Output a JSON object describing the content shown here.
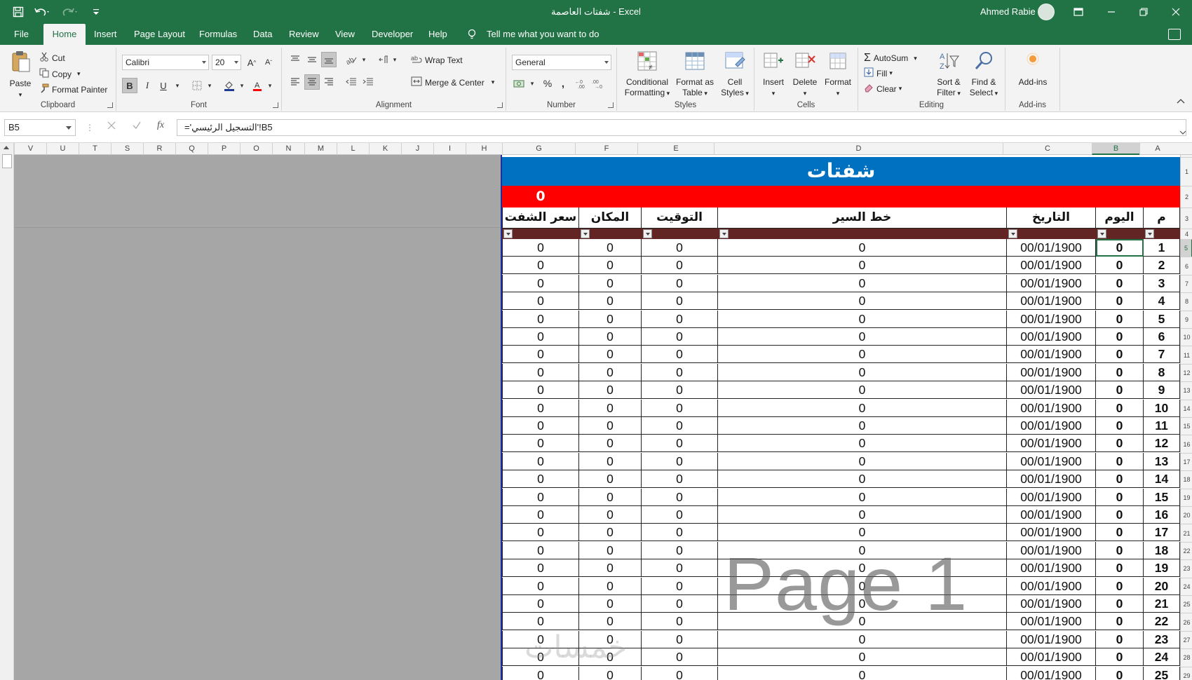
{
  "window": {
    "title": "شفتات العاصمة  -  Excel",
    "user": "Ahmed Rabie"
  },
  "menu": {
    "tabs": [
      "File",
      "Home",
      "Insert",
      "Page Layout",
      "Formulas",
      "Data",
      "Review",
      "View",
      "Developer",
      "Help"
    ],
    "active": "Home",
    "tellme": "Tell me what you want to do"
  },
  "ribbon": {
    "clipboard": {
      "label": "Clipboard",
      "paste": "Paste",
      "cut": "Cut",
      "copy": "Copy",
      "format_painter": "Format Painter"
    },
    "font": {
      "label": "Font",
      "name": "Calibri",
      "size": "20",
      "bold": "B",
      "italic": "I",
      "underline": "U"
    },
    "alignment": {
      "label": "Alignment",
      "wrap": "Wrap Text",
      "merge": "Merge & Center"
    },
    "number": {
      "label": "Number",
      "format": "General",
      "percent": "%",
      "comma": ","
    },
    "styles": {
      "label": "Styles",
      "conditional_1": "Conditional",
      "conditional_2": "Formatting",
      "format_table_1": "Format as",
      "format_table_2": "Table",
      "cell_styles_1": "Cell",
      "cell_styles_2": "Styles"
    },
    "cells": {
      "label": "Cells",
      "insert": "Insert",
      "delete": "Delete",
      "format": "Format"
    },
    "editing": {
      "label": "Editing",
      "autosum": "AutoSum",
      "fill": "Fill",
      "clear": "Clear",
      "sort_1": "Sort &",
      "sort_2": "Filter",
      "find_1": "Find &",
      "find_2": "Select"
    },
    "addins": {
      "label": "Add-ins",
      "button": "Add-ins"
    }
  },
  "formula_bar": {
    "name_box": "B5",
    "formula": "='التسجيل الرئيسي'!B5",
    "fx": "fx"
  },
  "columns": [
    "V",
    "U",
    "T",
    "S",
    "R",
    "Q",
    "P",
    "O",
    "N",
    "M",
    "L",
    "K",
    "J",
    "I",
    "H",
    "G",
    "F",
    "E",
    "D",
    "C",
    "B",
    "A"
  ],
  "sheet": {
    "title": "شفتات",
    "red_value": "0",
    "headers": [
      "سعر الشفت",
      "المكان",
      "التوقيت",
      "خط السير",
      "التاريخ",
      "اليوم",
      "م"
    ],
    "rows": [
      {
        "price": "0",
        "place": "0",
        "time": "0",
        "route": "0",
        "date": "00/01/1900",
        "day": "0",
        "n": "1"
      },
      {
        "price": "0",
        "place": "0",
        "time": "0",
        "route": "0",
        "date": "00/01/1900",
        "day": "0",
        "n": "2"
      },
      {
        "price": "0",
        "place": "0",
        "time": "0",
        "route": "0",
        "date": "00/01/1900",
        "day": "0",
        "n": "3"
      },
      {
        "price": "0",
        "place": "0",
        "time": "0",
        "route": "0",
        "date": "00/01/1900",
        "day": "0",
        "n": "4"
      },
      {
        "price": "0",
        "place": "0",
        "time": "0",
        "route": "0",
        "date": "00/01/1900",
        "day": "0",
        "n": "5"
      },
      {
        "price": "0",
        "place": "0",
        "time": "0",
        "route": "0",
        "date": "00/01/1900",
        "day": "0",
        "n": "6"
      },
      {
        "price": "0",
        "place": "0",
        "time": "0",
        "route": "0",
        "date": "00/01/1900",
        "day": "0",
        "n": "7"
      },
      {
        "price": "0",
        "place": "0",
        "time": "0",
        "route": "0",
        "date": "00/01/1900",
        "day": "0",
        "n": "8"
      },
      {
        "price": "0",
        "place": "0",
        "time": "0",
        "route": "0",
        "date": "00/01/1900",
        "day": "0",
        "n": "9"
      },
      {
        "price": "0",
        "place": "0",
        "time": "0",
        "route": "0",
        "date": "00/01/1900",
        "day": "0",
        "n": "10"
      },
      {
        "price": "0",
        "place": "0",
        "time": "0",
        "route": "0",
        "date": "00/01/1900",
        "day": "0",
        "n": "11"
      },
      {
        "price": "0",
        "place": "0",
        "time": "0",
        "route": "0",
        "date": "00/01/1900",
        "day": "0",
        "n": "12"
      },
      {
        "price": "0",
        "place": "0",
        "time": "0",
        "route": "0",
        "date": "00/01/1900",
        "day": "0",
        "n": "13"
      },
      {
        "price": "0",
        "place": "0",
        "time": "0",
        "route": "0",
        "date": "00/01/1900",
        "day": "0",
        "n": "14"
      },
      {
        "price": "0",
        "place": "0",
        "time": "0",
        "route": "0",
        "date": "00/01/1900",
        "day": "0",
        "n": "15"
      },
      {
        "price": "0",
        "place": "0",
        "time": "0",
        "route": "0",
        "date": "00/01/1900",
        "day": "0",
        "n": "16"
      },
      {
        "price": "0",
        "place": "0",
        "time": "0",
        "route": "0",
        "date": "00/01/1900",
        "day": "0",
        "n": "17"
      },
      {
        "price": "0",
        "place": "0",
        "time": "0",
        "route": "0",
        "date": "00/01/1900",
        "day": "0",
        "n": "18"
      },
      {
        "price": "0",
        "place": "0",
        "time": "0",
        "route": "0",
        "date": "00/01/1900",
        "day": "0",
        "n": "19"
      },
      {
        "price": "0",
        "place": "0",
        "time": "0",
        "route": "0",
        "date": "00/01/1900",
        "day": "0",
        "n": "20"
      },
      {
        "price": "0",
        "place": "0",
        "time": "0",
        "route": "0",
        "date": "00/01/1900",
        "day": "0",
        "n": "21"
      },
      {
        "price": "0",
        "place": "0",
        "time": "0",
        "route": "0",
        "date": "00/01/1900",
        "day": "0",
        "n": "22"
      },
      {
        "price": "0",
        "place": "0",
        "time": "0",
        "route": "0",
        "date": "00/01/1900",
        "day": "0",
        "n": "23"
      },
      {
        "price": "0",
        "place": "0",
        "time": "0",
        "route": "0",
        "date": "00/01/1900",
        "day": "0",
        "n": "24"
      },
      {
        "price": "0",
        "place": "0",
        "time": "0",
        "route": "0",
        "date": "00/01/1900",
        "day": "0",
        "n": "25"
      }
    ],
    "row_numbers": [
      "1",
      "2",
      "3",
      "4",
      "5",
      "6",
      "7",
      "8",
      "9",
      "10",
      "11",
      "12",
      "13",
      "14",
      "15",
      "16",
      "17",
      "18",
      "19",
      "20",
      "21",
      "22",
      "23",
      "24",
      "25",
      "26",
      "27",
      "28",
      "29"
    ],
    "selected_cell": "B5",
    "page_watermark": "Page 1",
    "logo_text": "خمسات"
  },
  "colors": {
    "excel_green": "#217346",
    "title_blue": "#0070c0",
    "red_bar": "#ff0000",
    "filter_bar": "#632523",
    "grey_outside": "#a6a6a6"
  }
}
